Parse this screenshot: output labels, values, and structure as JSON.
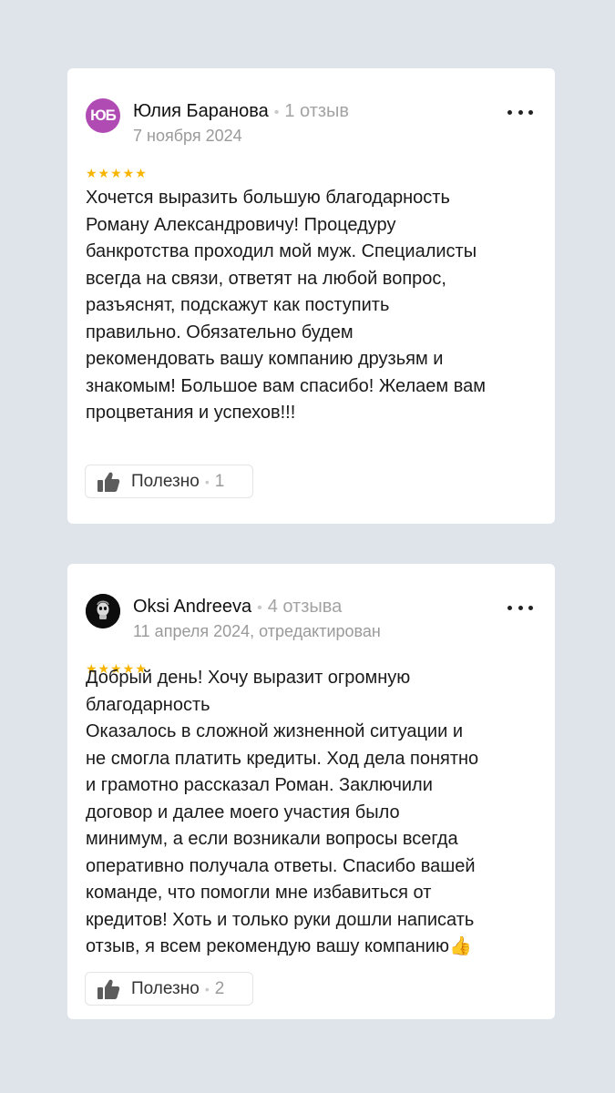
{
  "reviews": [
    {
      "author": "Юлия Баранова",
      "avatar_initials": "ЮБ",
      "review_count": "1 отзыв",
      "date": "7 ноября 2024",
      "rating": "★★★★★",
      "text": "Хочется выразить большую благодарность\nРоману Александровичу! Процедуру\nбанкротства проходил мой муж. Специалисты\nвсегда на связи, ответят на любой вопрос,\nразъяснят, подскажут как поступить\nправильно. Обязательно будем\nрекомендовать вашу компанию друзьям и\nзнакомым! Большое вам спасибо! Желаем вам\nпроцветания и успехов!!!",
      "helpful_label": "Полезно",
      "helpful_count": "1"
    },
    {
      "author": "Oksi Andreeva",
      "review_count": "4 отзыва",
      "date": "11 апреля 2024, отредактирован",
      "rating": "★★★★★",
      "text": "Добрый день! Хочу выразит огромную\nблагодарность\nОказалось в сложной жизненной ситуации и\nне смогла платить кредиты. Ход дела понятно\nи грамотно рассказал Роман. Заключили\nдоговор и далее моего участия было\nминимум, а если возникали вопросы всегда\nоперативно получала ответы. Спасибо вашей\nкоманде, что помогли мне избавиться от\nкредитов! Хоть и только руки дошли написать\nотзыв, я всем рекомендую вашу компанию👍",
      "helpful_label": "Полезно",
      "helpful_count": "2"
    }
  ],
  "separator": "•",
  "colors": {
    "background": "#dfe3ea",
    "card": "#ffffff",
    "star": "#f7b500",
    "avatar_initials_bg": "#b14bb4"
  },
  "icons": {
    "menu": "more-horizontal-icon",
    "helpful": "thumbs-up-icon",
    "star": "star-icon"
  }
}
